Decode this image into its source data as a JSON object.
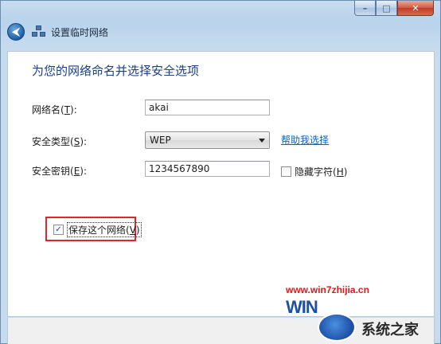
{
  "window": {
    "title": "设置临时网络",
    "caption_buttons": {
      "minimize": "–",
      "maximize": "□",
      "close": "✕"
    }
  },
  "nav": {
    "back_icon": "back-arrow-icon",
    "back_glyph": "⮜",
    "network_icon": "network-icon"
  },
  "main": {
    "heading": "为您的网络命名并选择安全选项",
    "network_name": {
      "label": "网络名(",
      "key": "T",
      "label_end": "):",
      "value": "akai"
    },
    "security_type": {
      "label": "安全类型(",
      "key": "S",
      "label_end": "):",
      "value": "WEP",
      "help_link": "帮助我选择"
    },
    "security_key": {
      "label": "安全密钥(",
      "key": "E",
      "label_end": "):",
      "value": "1234567890",
      "hide_chars": {
        "label": "隐藏字符(",
        "key": "H",
        "label_end": ")",
        "checked": false
      }
    },
    "save_network": {
      "label": "保存这个网络(",
      "key": "V",
      "label_end": ")",
      "checked": true,
      "check_glyph": "✓"
    }
  },
  "watermark": {
    "url": "www.win7zhijia.cn",
    "logo": "WIN",
    "name": "系统之家"
  },
  "colors": {
    "heading": "#1a3f8a",
    "link": "#0066cc",
    "highlight_box": "#e0262a",
    "watermark_url": "#e01818"
  }
}
